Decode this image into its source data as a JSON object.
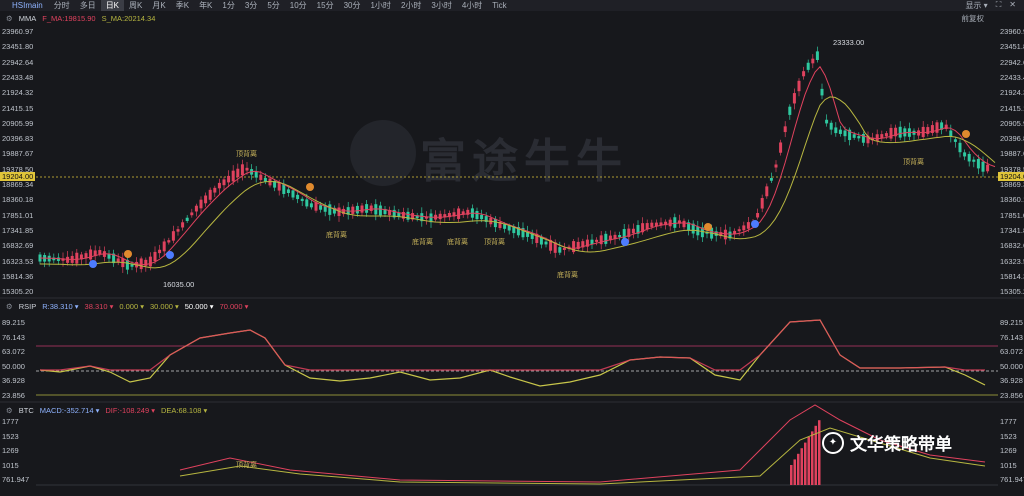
{
  "toolbar": {
    "symbol": "HSImain",
    "tabs": [
      "分时",
      "多日",
      "日K",
      "周K",
      "月K",
      "季K",
      "年K",
      "1分",
      "3分",
      "5分",
      "10分",
      "15分",
      "30分",
      "1小时",
      "2小时",
      "3小时",
      "4小时",
      "Tick"
    ],
    "active_tab": "日K",
    "right": [
      "显示 ▾",
      "⛶",
      "✕"
    ]
  },
  "main_panel": {
    "indicator": "MMA",
    "f_ma": "F_MA:19815.90",
    "s_ma": "S_MA:20214.34",
    "right_label": "前复权",
    "y_ticks": [
      "23960.97",
      "23451.80",
      "22942.64",
      "22433.48",
      "21924.32",
      "21415.15",
      "20905.99",
      "20396.83",
      "19887.67",
      "19378.50",
      "18869.34",
      "18360.18",
      "17851.01",
      "17341.85",
      "16832.69",
      "16323.53",
      "15814.36",
      "15305.20"
    ],
    "current_price": "19204.00",
    "high_callout": "23333.00",
    "low_callout": "16035.00",
    "watermark": "富途牛牛",
    "annotations": [
      {
        "text": "顶背离"
      },
      {
        "text": "底背离"
      },
      {
        "text": "底背离"
      },
      {
        "text": "底背离"
      },
      {
        "text": "顶背离"
      },
      {
        "text": "顶背离"
      },
      {
        "text": "底背离"
      }
    ]
  },
  "rsi_panel": {
    "indicator": "RSIP",
    "values": [
      "R:38.310 ▾",
      "38.310 ▾",
      "0.000 ▾",
      "30.000 ▾",
      "50.000 ▾",
      "70.000 ▾"
    ],
    "y_ticks": [
      "89.215",
      "76.143",
      "63.072",
      "50.000",
      "36.928",
      "23.856"
    ]
  },
  "macd_panel": {
    "indicator": "BTC",
    "values": [
      "MACD:-352.714 ▾",
      "DIF:-108.249 ▾",
      "DEA:68.108 ▾"
    ],
    "y_ticks": [
      "1777",
      "1523",
      "1269",
      "1015",
      "761.947"
    ],
    "annotation": "顶背离"
  },
  "overlay": {
    "wechat_label": "文华策略带单"
  },
  "colors": {
    "up": "#e0425e",
    "down": "#2fc9a0",
    "fast_ma": "#e0425e",
    "slow_ma": "#b7b640",
    "background": "#17181c"
  }
}
